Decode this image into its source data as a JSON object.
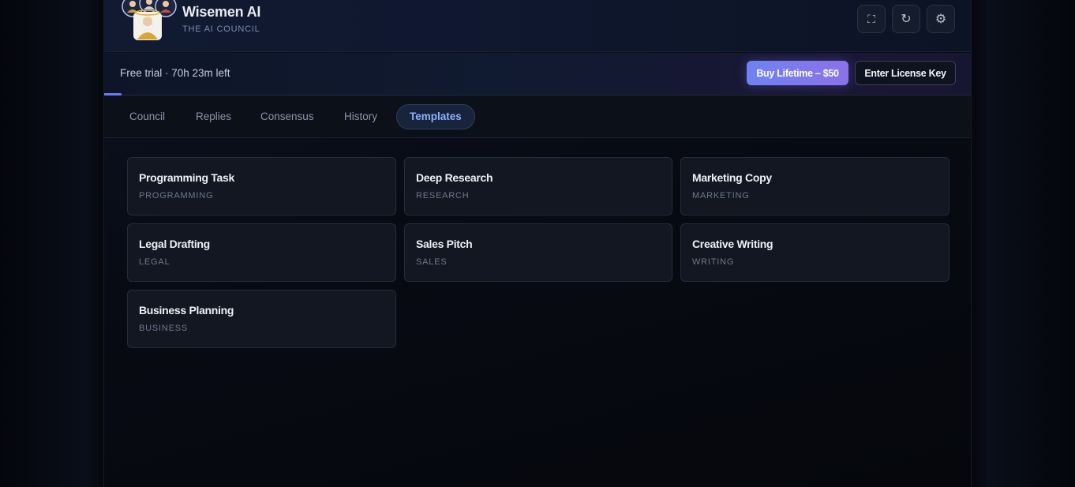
{
  "header": {
    "title": "Wisemen AI",
    "subtitle": "THE AI COUNCIL",
    "icons": [
      "fullscreen-icon",
      "refresh-icon",
      "settings-icon"
    ],
    "icon_glyphs": {
      "fullscreen": "⛶",
      "refresh": "↻",
      "settings": "⚙"
    }
  },
  "trial": {
    "text": "Free trial · 70h 23m left",
    "progress_percent": 2,
    "buy_label": "Buy Lifetime – $50",
    "license_label": "Enter License Key"
  },
  "tabs": [
    {
      "label": "Council",
      "active": false
    },
    {
      "label": "Replies",
      "active": false
    },
    {
      "label": "Consensus",
      "active": false
    },
    {
      "label": "History",
      "active": false
    },
    {
      "label": "Templates",
      "active": true
    }
  ],
  "templates": [
    {
      "title": "Programming Task",
      "category": "PROGRAMMING"
    },
    {
      "title": "Deep Research",
      "category": "RESEARCH"
    },
    {
      "title": "Marketing Copy",
      "category": "MARKETING"
    },
    {
      "title": "Legal Drafting",
      "category": "LEGAL"
    },
    {
      "title": "Sales Pitch",
      "category": "SALES"
    },
    {
      "title": "Creative Writing",
      "category": "WRITING"
    },
    {
      "title": "Business Planning",
      "category": "BUSINESS"
    }
  ],
  "colors": {
    "accent": "#6f78f2",
    "active_tab_text": "#8db0ff",
    "buy_gradient_start": "#6e83f2",
    "buy_gradient_end": "#8c71e8"
  }
}
